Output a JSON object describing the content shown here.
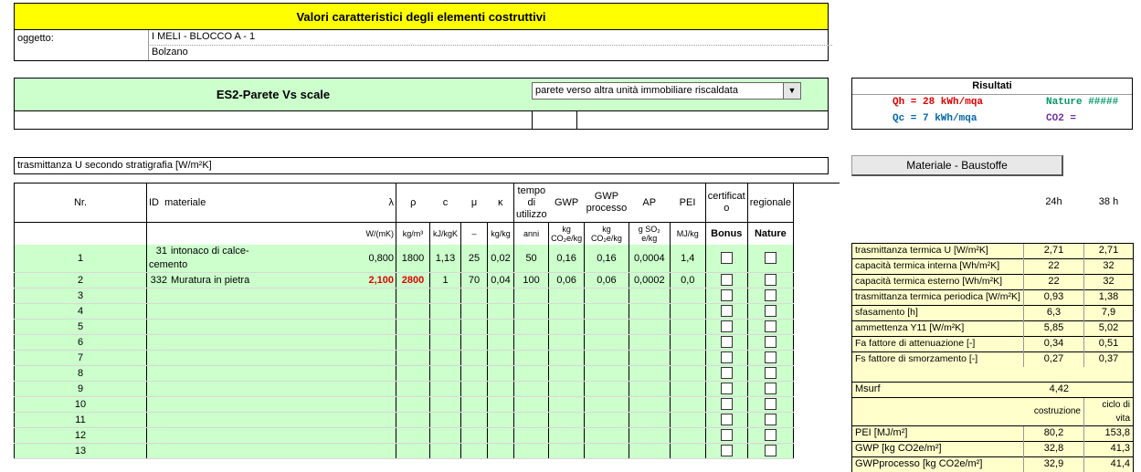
{
  "title": "Valori caratteristici degli elementi costruttivi",
  "info": {
    "oggetto_label": "oggetto:",
    "project": "I MELI - BLOCCO A - 1",
    "city": "Bolzano"
  },
  "element": {
    "name": "ES2-Parete Vs scale",
    "dropdown_value": "parete verso altra unità immobiliare riscaldata"
  },
  "risultati": {
    "title": "Risultati",
    "qh": "Qh = 28 kWh/mqa",
    "nature": "Nature  #####",
    "qc": "Qc = 7 kWh/mqa",
    "co2": "CO2 ="
  },
  "trasmittanza_label": "trasmittanza U secondo stratigrafia [W/m²K]",
  "material_button": "Materiale  - Baustoffe",
  "table": {
    "headers": {
      "nr": "Nr.",
      "id": "ID",
      "materiale": "materiale",
      "lambda": "λ",
      "rho": "ρ",
      "c": "c",
      "mu": "μ",
      "kappa": "κ",
      "tempo": "tempo di utilizzo",
      "gwp": "GWP",
      "gwp_processo": "GWP processo",
      "ap": "AP",
      "pei": "PEI",
      "certificato": "certificat o",
      "regionale": "regionale"
    },
    "units": {
      "lambda": "W/(mK)",
      "rho": "kg/m³",
      "c": "kJ/kgK",
      "mu": "–",
      "kappa": "kg/kg",
      "tempo": "anni",
      "gwp": "kg CO₂e/kg",
      "gwp_processo": "kg CO₂e/kg",
      "ap": "g SO₂ e/kg",
      "pei": "MJ/kg",
      "bonus": "Bonus",
      "nature": "Nature"
    },
    "rows": [
      {
        "nr": "1",
        "id": "31",
        "materiale": "intonaco di calce-cemento",
        "lambda": "0,800",
        "rho": "1800",
        "c": "1,13",
        "mu": "25",
        "kappa": "0,02",
        "tempo": "50",
        "gwp": "0,16",
        "gwp_p": "0,16",
        "ap": "0,0004",
        "pei": "1,4"
      },
      {
        "nr": "2",
        "id": "332",
        "materiale": "Muratura in pietra",
        "lambda": "2,100",
        "rho": "2800",
        "c": "1",
        "mu": "70",
        "kappa": "0,04",
        "tempo": "100",
        "gwp": "0,06",
        "gwp_p": "0,06",
        "ap": "0,0002",
        "pei": "0,0"
      },
      {
        "nr": "3"
      },
      {
        "nr": "4"
      },
      {
        "nr": "5"
      },
      {
        "nr": "6"
      },
      {
        "nr": "7"
      },
      {
        "nr": "8"
      },
      {
        "nr": "9"
      },
      {
        "nr": "10"
      },
      {
        "nr": "11"
      },
      {
        "nr": "12"
      },
      {
        "nr": "13"
      }
    ]
  },
  "right": {
    "col_24h": "24h",
    "col_38h": "38 h",
    "props": [
      {
        "label": "trasmittanza termica U [W/m²K]",
        "v24": "2,71",
        "v38": "2,71"
      },
      {
        "label": "capacità termica interna [Wh/m²K]",
        "v24": "22",
        "v38": "32"
      },
      {
        "label": "capacità termica esterno [Wh/m²K]",
        "v24": "22",
        "v38": "32"
      },
      {
        "label": "trasmittanza termica periodica [W/m²K]",
        "v24": "0,93",
        "v38": "1,38"
      },
      {
        "label": "sfasamento [h]",
        "v24": "6,3",
        "v38": "7,9"
      },
      {
        "label": "ammettenza Y11 [W/m²K]",
        "v24": "5,85",
        "v38": "5,02"
      },
      {
        "label": "Fa fattore di attenuazione [-]",
        "v24": "0,34",
        "v38": "0,51"
      },
      {
        "label": "Fs fattore di smorzamento [-]",
        "v24": "0,27",
        "v38": "0,37"
      }
    ],
    "msurf_label": "Msurf",
    "msurf_value": "4,42",
    "col_costruzione": "costruzione",
    "col_ciclo": "ciclo di vita",
    "eco": [
      {
        "label": "PEI [MJ/m²]",
        "c": "80,2",
        "v": "153,8"
      },
      {
        "label": "GWP [kg CO2e/m²]",
        "c": "32,8",
        "v": "41,3"
      },
      {
        "label": "GWPprocesso [kg CO2e/m²]",
        "c": "32,9",
        "v": "41,4"
      }
    ]
  }
}
